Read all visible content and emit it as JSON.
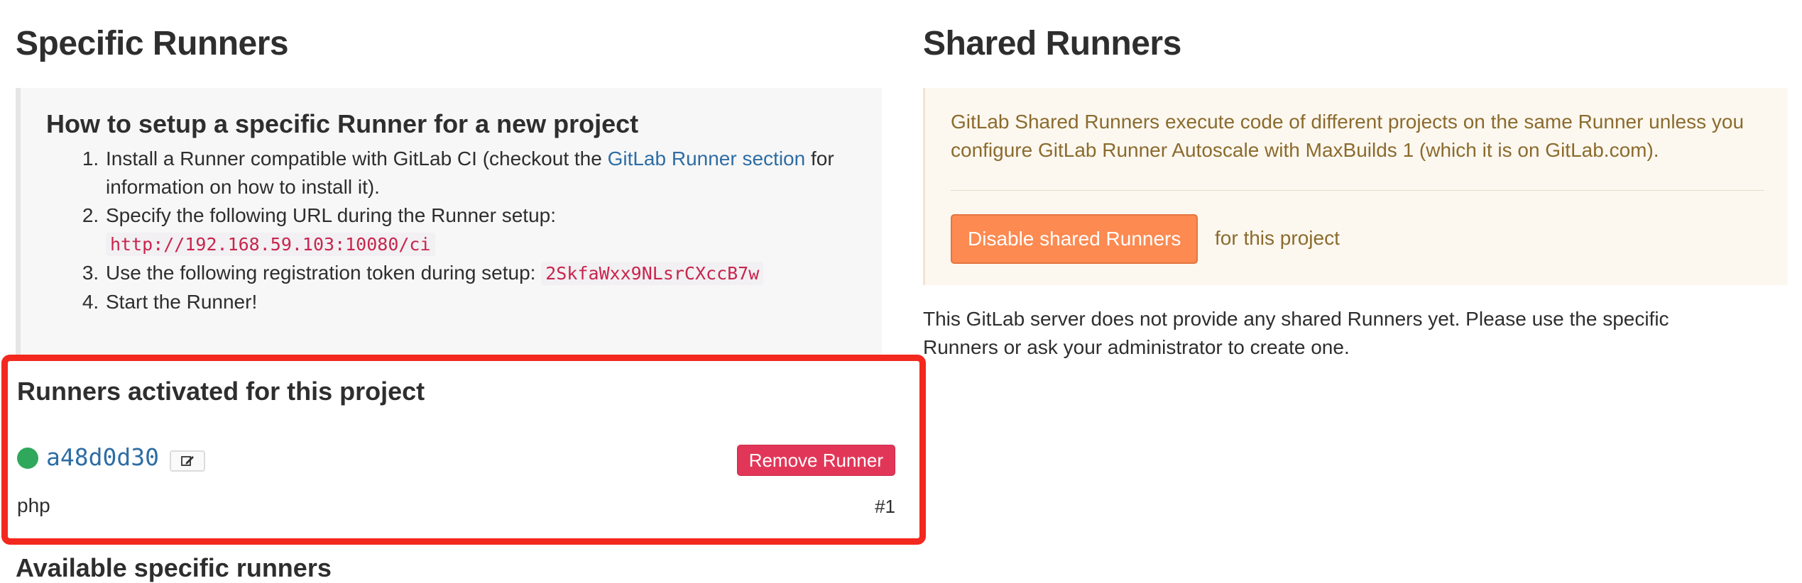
{
  "specific": {
    "title": "Specific Runners",
    "help": {
      "heading": "How to setup a specific Runner for a new project",
      "step1_prefix": "Install a Runner compatible with GitLab CI (checkout the ",
      "step1_link": "GitLab Runner section",
      "step1_suffix": " for information on how to install it).",
      "step2_text": "Specify the following URL during the Runner setup:",
      "step2_url": "http://192.168.59.103:10080/ci",
      "step3_text": "Use the following registration token during setup: ",
      "step3_token": "2SkfaWxx9NLsrCXccB7w",
      "step4_text": "Start the Runner!"
    },
    "activated": {
      "heading": "Runners activated for this project",
      "runner": {
        "token": "a48d0d30",
        "status_color": "#2fa85b",
        "edit_icon": "edit-icon",
        "remove_label": "Remove Runner",
        "tag": "php",
        "number": "#1"
      }
    },
    "available_heading": "Available specific runners"
  },
  "shared": {
    "title": "Shared Runners",
    "info": "GitLab Shared Runners execute code of different projects on the same Runner unless you configure GitLab Runner Autoscale with MaxBuilds 1 (which it is on GitLab.com).",
    "disable_label": "Disable shared Runners",
    "for_project": "for this project",
    "note": "This GitLab server does not provide any shared Runners yet. Please use the specific Runners or ask your administrator to create one."
  }
}
